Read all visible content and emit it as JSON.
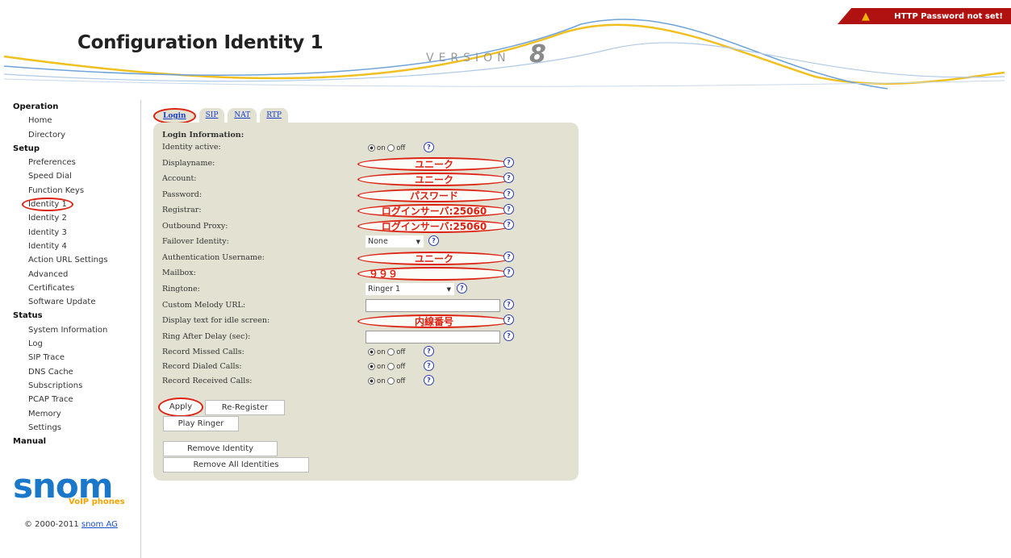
{
  "header": {
    "title": "Configuration Identity 1",
    "version_label": "VERSION",
    "version_number": "8",
    "warning": "HTTP Password not set!"
  },
  "sidebar": {
    "sections": [
      {
        "title": "Operation",
        "items": [
          "Home",
          "Directory"
        ]
      },
      {
        "title": "Setup",
        "items": [
          "Preferences",
          "Speed Dial",
          "Function Keys",
          "Identity 1",
          "Identity 2",
          "Identity 3",
          "Identity 4",
          "Action URL Settings",
          "Advanced",
          "Certificates",
          "Software Update"
        ]
      },
      {
        "title": "Status",
        "items": [
          "System Information",
          "Log",
          "SIP Trace",
          "DNS Cache",
          "Subscriptions",
          "PCAP Trace",
          "Memory",
          "Settings"
        ]
      },
      {
        "title": "Manual",
        "items": []
      }
    ],
    "active_item": "Identity 1"
  },
  "logo": {
    "brand": "snom",
    "sub": "VoIP phones"
  },
  "copyright": {
    "text": "© 2000-2011 ",
    "link": "snom AG"
  },
  "tabs": [
    "Login",
    "SIP",
    "NAT",
    "RTP"
  ],
  "form": {
    "heading": "Login Information:",
    "labels": {
      "identity_active": "Identity active:",
      "displayname": "Displayname:",
      "account": "Account:",
      "password": "Password:",
      "registrar": "Registrar:",
      "outbound_proxy": "Outbound Proxy:",
      "failover": "Failover Identity:",
      "auth_user": "Authentication Username:",
      "mailbox": "Mailbox:",
      "ringtone": "Ringtone:",
      "custom_melody": "Custom Melody URL:",
      "idle_text": "Display text for idle screen:",
      "ring_after": "Ring After Delay (sec):",
      "missed": "Record Missed Calls:",
      "dialed": "Record Dialed Calls:",
      "received": "Record Received Calls:"
    },
    "values": {
      "displayname": "ユニーク",
      "account": "ユニーク",
      "password": "パスワード",
      "registrar": "ログインサーバ:25060",
      "outbound_proxy": "ログインサーバ:25060",
      "failover": "None",
      "auth_user": "ユニーク",
      "mailbox": "９９９",
      "ringtone": "Ringer 1",
      "idle_text": "内線番号"
    },
    "radio_on": "on",
    "radio_off": "off"
  },
  "buttons": {
    "apply": "Apply",
    "reregister": "Re-Register",
    "play_ringer": "Play Ringer",
    "remove_identity": "Remove Identity",
    "remove_all": "Remove All Identities"
  }
}
